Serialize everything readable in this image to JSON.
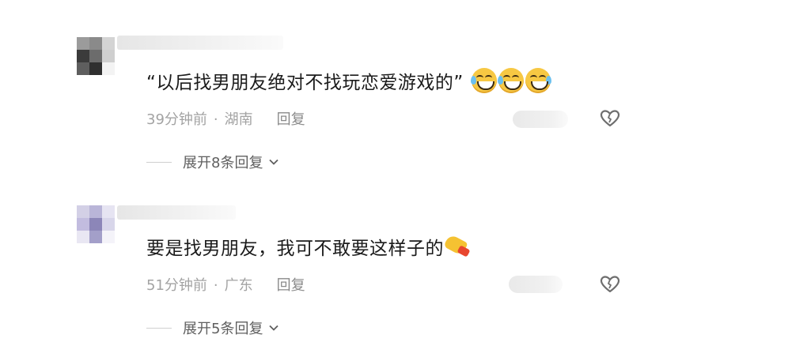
{
  "comments": [
    {
      "text": "“以后找男朋友绝对不找玩恋爱游戏的”",
      "emoji": "grinning-sweat-face-icon x3",
      "time": "39分钟前",
      "separator": "·",
      "location": "湖南",
      "reply_label": "回复",
      "expand_label": "展开8条回复"
    },
    {
      "text": "要是找男朋友，我可不敢要这样子的",
      "emoji": "dog-paw-icon",
      "time": "51分钟前",
      "separator": "·",
      "location": "广东",
      "reply_label": "回复",
      "expand_label": "展开5条回复"
    }
  ],
  "colors": {
    "background": "#ffffff",
    "text": "#1b1b1b",
    "meta": "#a3a3a3",
    "emoji_yellow": "#f7c843"
  }
}
